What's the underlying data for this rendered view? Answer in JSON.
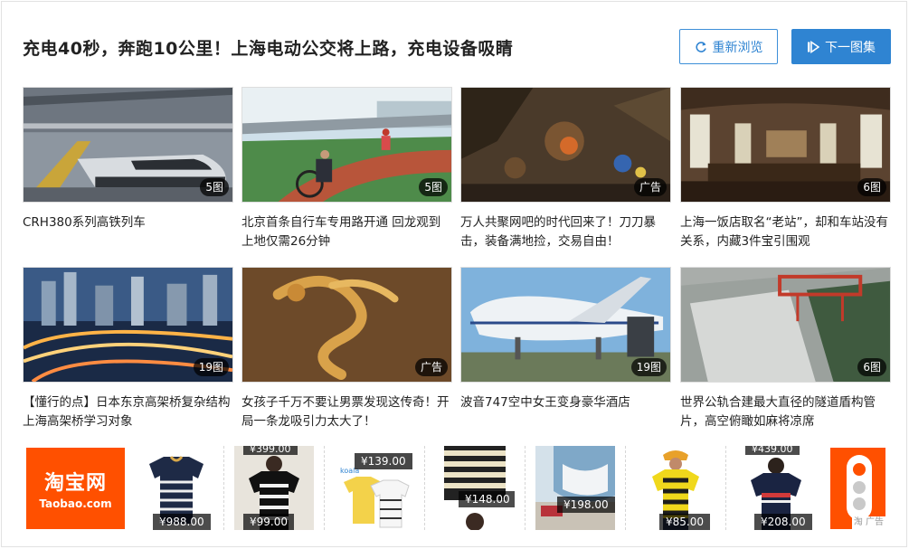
{
  "header": {
    "title": "充电40秒，奔跑10公里！上海电动公交将上路，充电设备吸睛",
    "refresh_label": "重新浏览",
    "next_label": "下一图集"
  },
  "cards": [
    {
      "caption": "CRH380系列高铁列车",
      "badge": "5图"
    },
    {
      "caption": "北京首条自行车专用路开通 回龙观到上地仅需26分钟",
      "badge": "5图"
    },
    {
      "caption": "万人共聚网吧的时代回来了！刀刀暴击，装备满地捡，交易自由！",
      "badge": "广告"
    },
    {
      "caption": "上海一饭店取名“老站”，却和车站没有关系，内藏3件宝引围观",
      "badge": "6图"
    },
    {
      "caption": "【懂行的点】日本东京高架桥复杂结构 上海高架桥学习对象",
      "badge": "19图"
    },
    {
      "caption": "女孩子千万不要让男票发现这传奇！开局一条龙吸引力太大了！",
      "badge": "广告"
    },
    {
      "caption": "波音747空中女王变身豪华酒店",
      "badge": "19图"
    },
    {
      "caption": "世界公轨合建最大直径的隧道盾构管片，高空俯瞰如麻将凉席",
      "badge": "6图"
    }
  ],
  "ads": {
    "taobao_cn": "淘宝网",
    "taobao_en": "Taobao.com",
    "ad_label": "广告",
    "ad_logo_char": "淘",
    "products": [
      {
        "price": "¥988.00"
      },
      {
        "price": "¥99.00",
        "top_price": "¥399.00"
      },
      {
        "price": "¥139.00",
        "brand": "koala"
      },
      {
        "price": "¥148.00"
      },
      {
        "price": "¥198.00"
      },
      {
        "price": "¥85.00"
      },
      {
        "price": "¥208.00",
        "top_price": "¥439.00"
      }
    ]
  },
  "colors": {
    "accent": "#2f84d2",
    "taobao_orange": "#ff5000"
  }
}
